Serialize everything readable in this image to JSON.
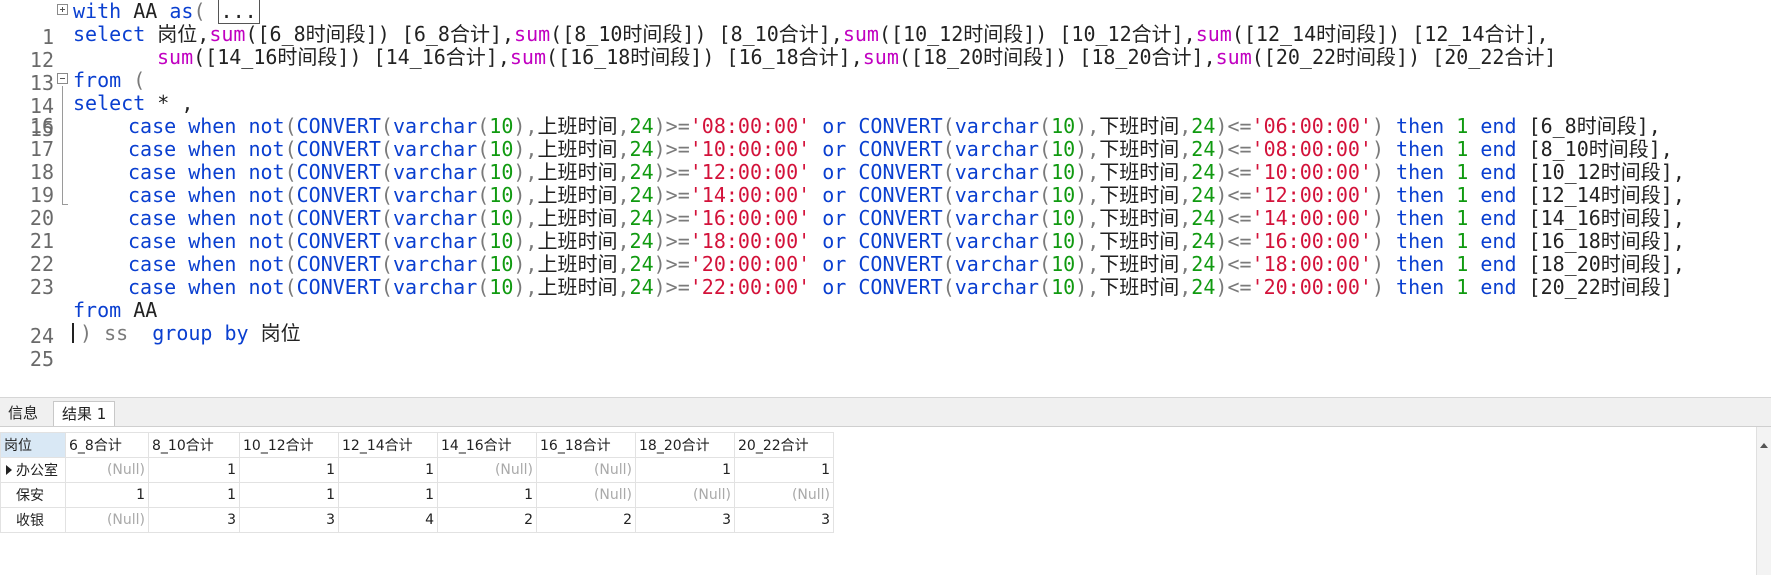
{
  "editor": {
    "line_numbers": [
      "1",
      "12",
      "13",
      "14",
      "15",
      "16",
      "17",
      "18",
      "19",
      "20",
      "21",
      "22",
      "23",
      "24",
      "25"
    ],
    "line1": {
      "kw_with": "with",
      "name": " AA ",
      "kw_as": "as",
      "paren": "( ",
      "collapsed": "..."
    },
    "line12": {
      "kw_select": "select",
      "p1": " 岗位,",
      "sum1": "sum",
      "a1": "([6_8时间段]) [6_8合计],",
      "sum2": "sum",
      "a2": "([8_10时间段]) [8_10合计],",
      "sum3": "sum",
      "a3": "([10_12时间段]) [10_12合计],",
      "sum4": "sum",
      "a4": "([12_14时间段]) [12_14合计],"
    },
    "line13": {
      "sum1": "sum",
      "a1": "([14_16时间段]) [14_16合计],",
      "sum2": "sum",
      "a2": "([16_18时间段]) [16_18合计],",
      "sum3": "sum",
      "a3": "([18_20时间段]) [18_20合计],",
      "sum4": "sum",
      "a4": "([20_22时间段]) [20_22合计]"
    },
    "line14": {
      "kw_from": "from",
      "rest": " ("
    },
    "line15": {
      "kw_select": "select",
      "rest": " * ,"
    },
    "case_lines": [
      {
        "t1": "'08:00:00'",
        "t2": "'06:00:00'",
        "alias": "[6_8时间段],"
      },
      {
        "t1": "'10:00:00'",
        "t2": "'08:00:00'",
        "alias": "[8_10时间段],"
      },
      {
        "t1": "'12:00:00'",
        "t2": "'10:00:00'",
        "alias": "[10_12时间段],"
      },
      {
        "t1": "'14:00:00'",
        "t2": "'12:00:00'",
        "alias": "[12_14时间段],"
      },
      {
        "t1": "'16:00:00'",
        "t2": "'14:00:00'",
        "alias": "[14_16时间段],"
      },
      {
        "t1": "'18:00:00'",
        "t2": "'16:00:00'",
        "alias": "[16_18时间段],"
      },
      {
        "t1": "'20:00:00'",
        "t2": "'18:00:00'",
        "alias": "[18_20时间段],"
      },
      {
        "t1": "'22:00:00'",
        "t2": "'20:00:00'",
        "alias": "[20_22时间段]"
      }
    ],
    "case_tokens": {
      "case": "case",
      "when": "when",
      "not": "not",
      "convert": "CONVERT",
      "varchar": "varchar",
      "len": "10",
      "col_on": "上班时间",
      "style": "24",
      "ge": ">=",
      "le": "<=",
      "or": "or",
      "col_off": "下班时间",
      "then": "then",
      "one": "1",
      "end": "end"
    },
    "line24": {
      "kw_from": "from",
      "rest": " AA"
    },
    "line25": {
      "rest": ") ss  ",
      "kw_group": "group",
      "kw_by": "by",
      "col": " 岗位"
    }
  },
  "tabs": {
    "info": "信息",
    "result": "结果 1"
  },
  "grid": {
    "columns": [
      "岗位",
      "6_8合计",
      "8_10合计",
      "10_12合计",
      "12_14合计",
      "14_16合计",
      "16_18合计",
      "18_20合计",
      "20_22合计"
    ],
    "rows": [
      [
        "办公室",
        "(Null)",
        "1",
        "1",
        "1",
        "(Null)",
        "(Null)",
        "1",
        "1"
      ],
      [
        "保安",
        "1",
        "1",
        "1",
        "1",
        "1",
        "(Null)",
        "(Null)",
        "(Null)"
      ],
      [
        "收银",
        "(Null)",
        "3",
        "3",
        "4",
        "2",
        "2",
        "3",
        "3"
      ]
    ]
  },
  "colors": {
    "keyword": "#0a3fd0",
    "function": "#c100c1",
    "string": "#d3123a",
    "number": "#109a10",
    "null": "#a9a9a9",
    "header_selected": "#d9e8f5"
  }
}
